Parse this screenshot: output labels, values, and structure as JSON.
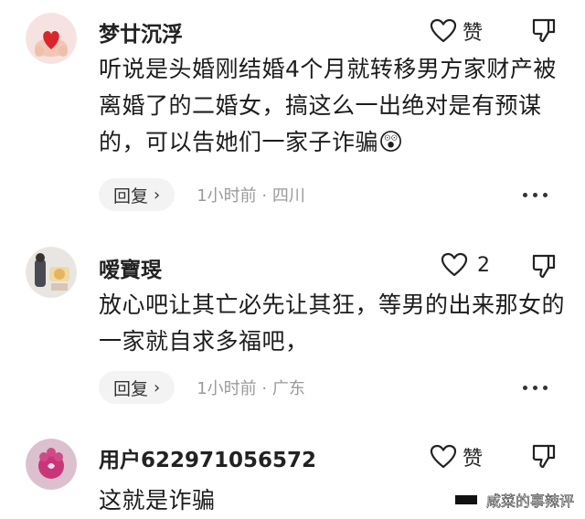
{
  "comments": [
    {
      "username": "梦廿沉浮",
      "like_label": "赞",
      "text": "听说是头婚刚结婚4个月就转移男方家财产被离婚了的二婚女，搞这么一出绝对是有预谋的，可以告她们一家子诈骗",
      "emoji": "😲",
      "reply_label": "回复",
      "time": "1小时前 · 四川"
    },
    {
      "username": "嗳寶琝",
      "like_count": "2",
      "text": "放心吧让其亡必先让其狂，等男的出来那女的一家就自求多福吧，",
      "reply_label": "回复",
      "time": "1小时前 · 广东"
    },
    {
      "username": "用户622971056572",
      "like_label": "赞",
      "text": "这就是诈骗"
    }
  ],
  "watermark": "咸菜的事辣评",
  "icons": {
    "like": "heart-outline-icon",
    "dislike": "thumbs-down-icon",
    "more": "more-dots-icon",
    "chevron": "chevron-right-icon"
  }
}
